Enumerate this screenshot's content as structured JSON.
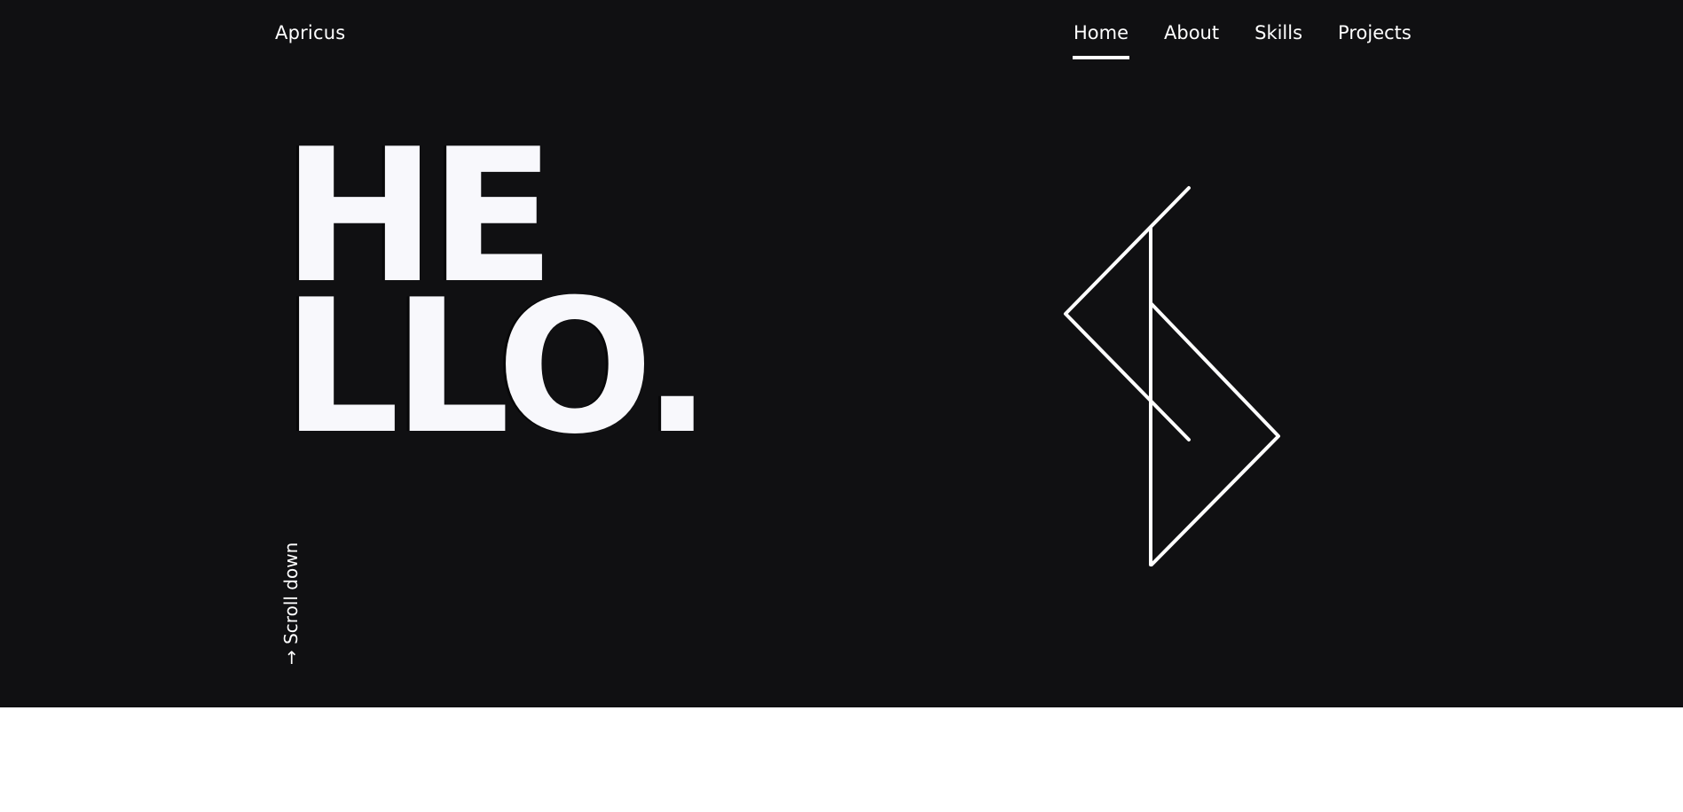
{
  "header": {
    "brand": "Apricus",
    "nav": [
      {
        "label": "Home",
        "active": true
      },
      {
        "label": "About",
        "active": false
      },
      {
        "label": "Skills",
        "active": false
      },
      {
        "label": "Projects",
        "active": false
      }
    ]
  },
  "hero": {
    "line1": "HE",
    "line2": "LLO.",
    "scroll_label": "→ Scroll down",
    "logo_icon": "geometric-line-logo-icon"
  },
  "colors": {
    "hero_bg": "#101012",
    "text": "#ffffff",
    "page_bg": "#ffffff"
  }
}
